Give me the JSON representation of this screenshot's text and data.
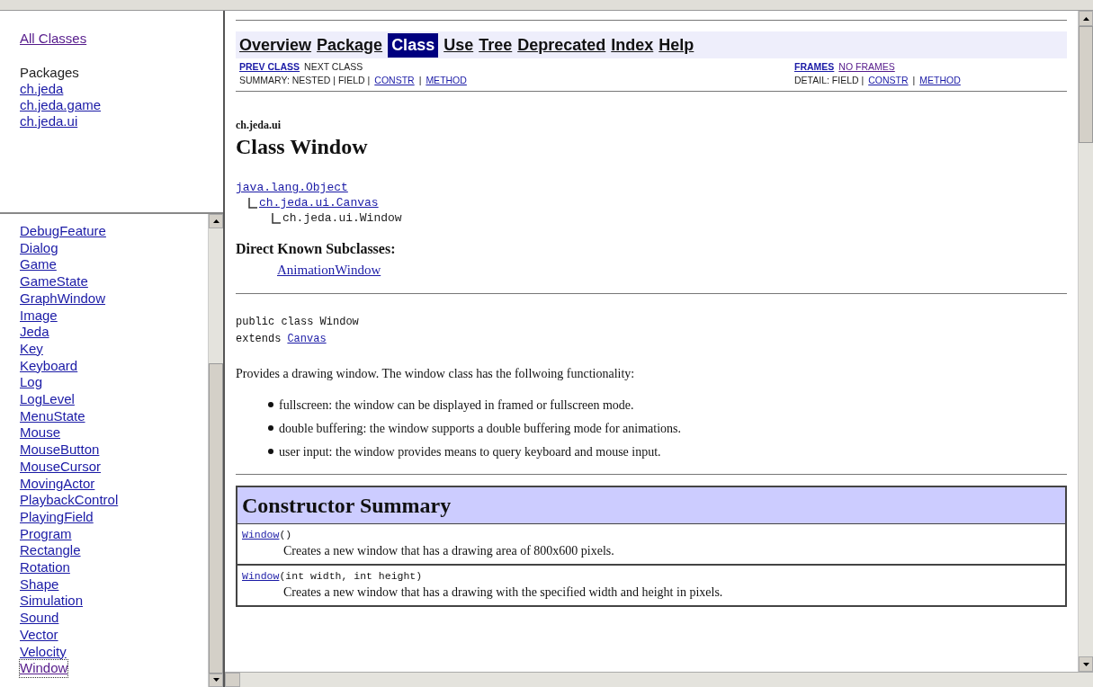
{
  "packages_pane": {
    "all_classes": {
      "label": "All Classes",
      "visited": true
    },
    "heading": "Packages",
    "packages": [
      {
        "label": "ch.jeda",
        "visited": false
      },
      {
        "label": "ch.jeda.game",
        "visited": false
      },
      {
        "label": "ch.jeda.ui",
        "visited": false
      }
    ]
  },
  "classes_pane": {
    "classes": [
      {
        "label": "DebugFeature",
        "focused": false
      },
      {
        "label": "Dialog",
        "focused": false
      },
      {
        "label": "Game",
        "focused": false
      },
      {
        "label": "GameState",
        "focused": false
      },
      {
        "label": "GraphWindow",
        "focused": false
      },
      {
        "label": "Image",
        "focused": false
      },
      {
        "label": "Jeda",
        "focused": false
      },
      {
        "label": "Key",
        "focused": false
      },
      {
        "label": "Keyboard",
        "focused": false
      },
      {
        "label": "Log",
        "focused": false
      },
      {
        "label": "LogLevel",
        "focused": false
      },
      {
        "label": "MenuState",
        "focused": false
      },
      {
        "label": "Mouse",
        "focused": false
      },
      {
        "label": "MouseButton",
        "focused": false
      },
      {
        "label": "MouseCursor",
        "focused": false
      },
      {
        "label": "MovingActor",
        "focused": false
      },
      {
        "label": "PlaybackControl",
        "focused": false
      },
      {
        "label": "PlayingField",
        "focused": false
      },
      {
        "label": "Program",
        "focused": false
      },
      {
        "label": "Rectangle",
        "focused": false
      },
      {
        "label": "Rotation",
        "focused": false
      },
      {
        "label": "Shape",
        "focused": false
      },
      {
        "label": "Simulation",
        "focused": false
      },
      {
        "label": "Sound",
        "focused": false
      },
      {
        "label": "Vector",
        "focused": false
      },
      {
        "label": "Velocity",
        "focused": false
      },
      {
        "label": "Window",
        "focused": true
      }
    ]
  },
  "nav_bar": {
    "items": [
      {
        "label": "Overview",
        "selected": false
      },
      {
        "label": "Package",
        "selected": false
      },
      {
        "label": "Class",
        "selected": true
      },
      {
        "label": "Use",
        "selected": false
      },
      {
        "label": "Tree",
        "selected": false
      },
      {
        "label": "Deprecated",
        "selected": false
      },
      {
        "label": "Index",
        "selected": false
      },
      {
        "label": "Help",
        "selected": false
      }
    ],
    "left_rows": [
      [
        {
          "kind": "link",
          "label": "PREV CLASS",
          "visited": false
        },
        {
          "kind": "text",
          "label": "NEXT CLASS"
        }
      ],
      [
        {
          "kind": "text",
          "label": "SUMMARY: NESTED | FIELD |"
        },
        {
          "kind": "link",
          "label": "CONSTR",
          "visited": false
        },
        {
          "kind": "text",
          "label": "|"
        },
        {
          "kind": "link",
          "label": "METHOD",
          "visited": false
        }
      ]
    ],
    "right_rows": [
      [
        {
          "kind": "link",
          "label": "FRAMES",
          "visited": false
        },
        {
          "kind": "link",
          "label": "NO FRAMES",
          "visited": true
        }
      ],
      [
        {
          "kind": "text",
          "label": "DETAIL: FIELD |"
        },
        {
          "kind": "link",
          "label": "CONSTR",
          "visited": false
        },
        {
          "kind": "text",
          "label": "|"
        },
        {
          "kind": "link",
          "label": "METHOD",
          "visited": false
        }
      ]
    ]
  },
  "package_name": "ch.jeda.ui",
  "title": "Class Window",
  "hierarchy": [
    {
      "label": "java.lang.Object",
      "link": true,
      "children": [
        {
          "label": "ch.jeda.ui.Canvas",
          "link": true,
          "children": [
            {
              "label": "ch.jeda.ui.Window",
              "link": false
            }
          ]
        }
      ]
    }
  ],
  "subclasses": {
    "heading": "Direct Known Subclasses:",
    "items": [
      "AnimationWindow"
    ]
  },
  "declaration": {
    "line_1": "public class Window",
    "extends_keyword": "extends",
    "extends_link": "Canvas"
  },
  "description": "Provides a drawing window. The window class has the follwoing functionality:",
  "features": [
    "fullscreen: the window can be displayed in framed or fullscreen mode.",
    "double buffering: the window supports a double buffering mode for animations.",
    "user input: the window provides means to query keyboard and mouse input."
  ],
  "constructor_summary": {
    "heading": "Constructor Summary",
    "rows": [
      {
        "name": "Window",
        "params": "()",
        "text": "Creates a new window that has a drawing area of 800x600 pixels."
      },
      {
        "name": "Window",
        "params": "(int width, int height)",
        "text": "Creates a new window that has a drawing with the specified width and height in pixels."
      }
    ]
  }
}
